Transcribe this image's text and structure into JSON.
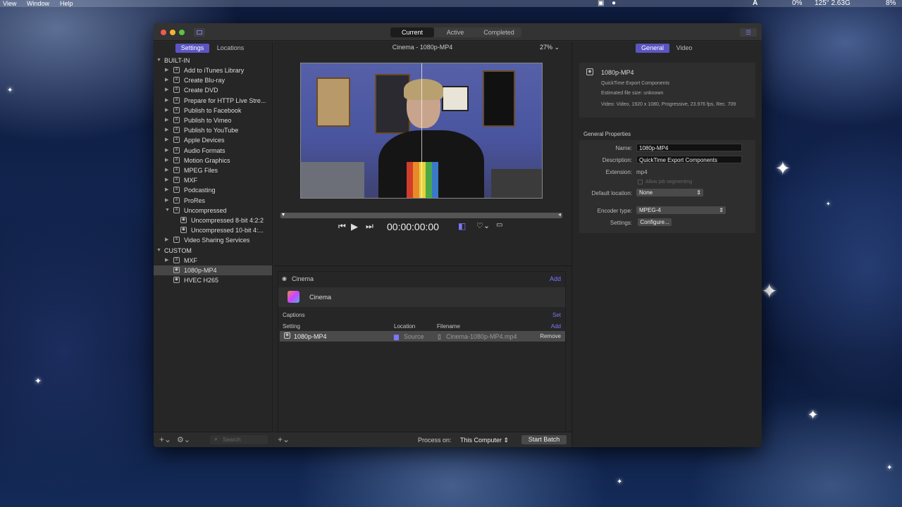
{
  "menubar": {
    "items": [
      "View",
      "Window",
      "Help"
    ],
    "status": {
      "cpu": "0%",
      "temp": "125° 2.63G",
      "battery": "8%",
      "a_icon": "A"
    }
  },
  "window": {
    "segments": [
      "Current",
      "Active",
      "Completed"
    ],
    "active_segment": "Current"
  },
  "left": {
    "tabs": [
      "Settings",
      "Locations"
    ],
    "builtin_header": "BUILT-IN",
    "builtin_items": [
      "Add to iTunes Library",
      "Create Blu-ray",
      "Create DVD",
      "Prepare for HTTP Live Stre...",
      "Publish to Facebook",
      "Publish to Vimeo",
      "Publish to YouTube",
      "Apple Devices",
      "Audio Formats",
      "Motion Graphics",
      "MPEG Files",
      "MXF",
      "Podcasting",
      "ProRes",
      "Uncompressed",
      "Uncompressed 8-bit 4:2:2",
      "Uncompressed 10-bit 4:...",
      "Video Sharing Services"
    ],
    "custom_header": "CUSTOM",
    "custom_items": [
      "MXF",
      "1080p-MP4",
      "HVEC H265"
    ],
    "search_placeholder": "Search"
  },
  "middle": {
    "title": "Cinema - 1080p-MP4",
    "zoom": "27%",
    "timecode": "00:00:00:00",
    "job": {
      "header": "Cinema",
      "add_label": "Add",
      "name": "Cinema",
      "captions_label": "Captions",
      "set_label": "Set",
      "columns": [
        "Setting",
        "Location",
        "Filename"
      ],
      "add_output_label": "Add",
      "output": {
        "setting": "1080p-MP4",
        "location": "Source",
        "filename": "Cinema-1080p-MP4.mp4",
        "remove": "Remove"
      }
    },
    "process_on_label": "Process on:",
    "process_on_value": "This Computer",
    "start_batch": "Start Batch"
  },
  "right": {
    "tabs": [
      "General",
      "Video"
    ],
    "summary": {
      "name": "1080p-MP4",
      "line1": "QuickTime Export Components",
      "line2": "Estimated file size: unknown",
      "line3": "Video: Video, 1920 x 1080, Progressive, 23.976 fps, Rec. 709"
    },
    "general_properties": "General Properties",
    "props": {
      "name_label": "Name:",
      "name_value": "1080p-MP4",
      "description_label": "Description:",
      "description_value": "QuickTime Export Components",
      "extension_label": "Extension:",
      "extension_value": "mp4",
      "segmenting_label": "Allow job segmenting",
      "default_location_label": "Default location:",
      "default_location_value": "None",
      "encoder_label": "Encoder type:",
      "encoder_value": "MPEG-4",
      "settings_label": "Settings:",
      "configure": "Configure..."
    }
  },
  "colors": {
    "accent": "#5b55c2",
    "link": "#7d76ff",
    "window_bg": "#262626"
  }
}
